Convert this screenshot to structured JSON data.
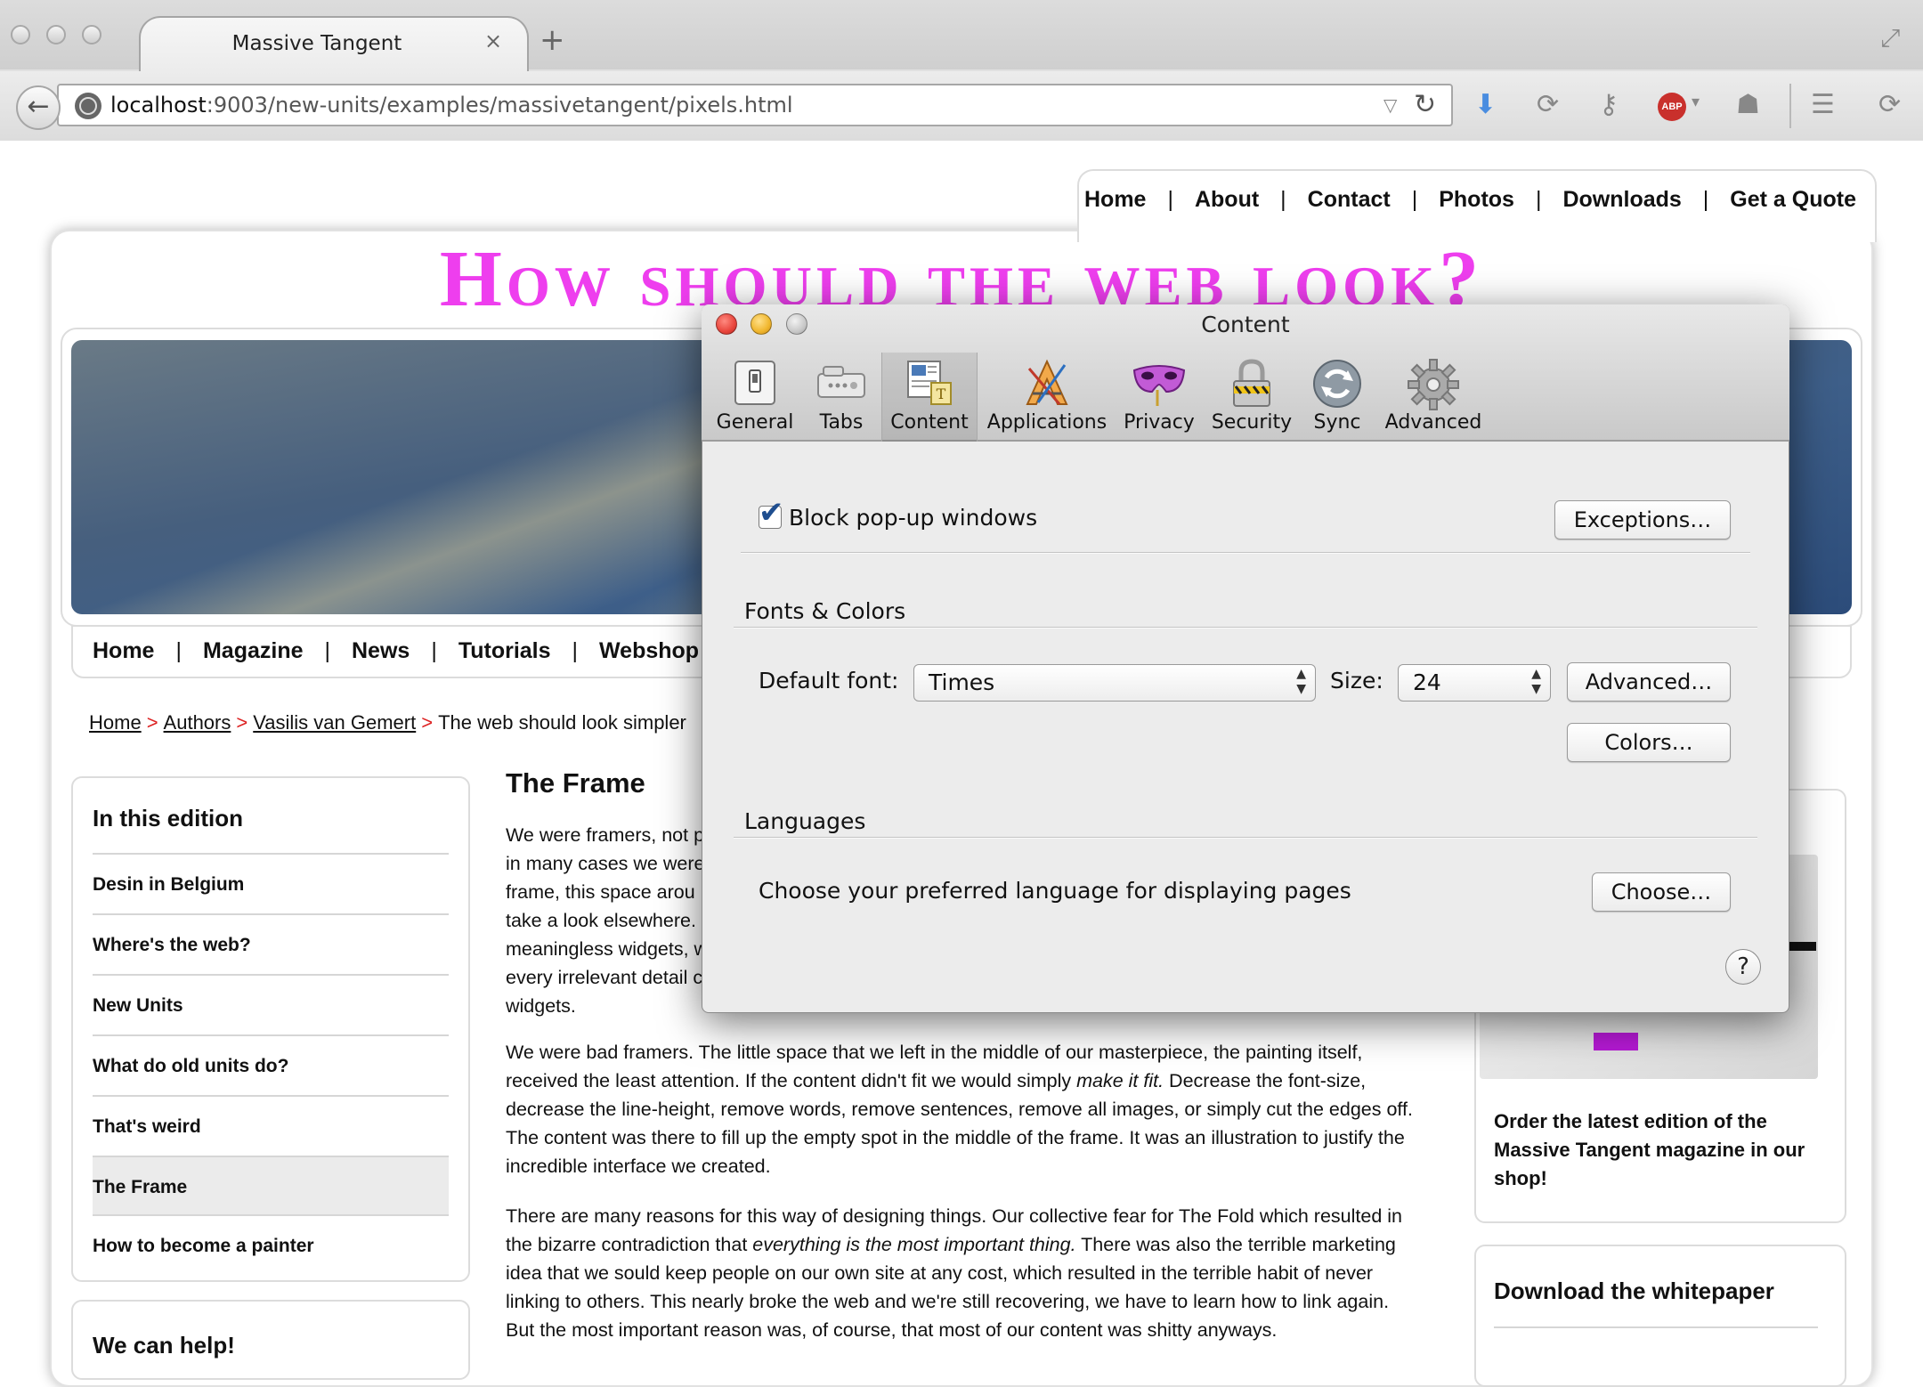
{
  "browser": {
    "tab_title": "Massive Tangent",
    "tab_close": "×",
    "new_tab": "+",
    "back_glyph": "←",
    "url_host": "localhost",
    "url_rest": ":9003/new-units/examples/massivetangent/pixels.html"
  },
  "page": {
    "top_nav": [
      "Home",
      "About",
      "Contact",
      "Photos",
      "Downloads",
      "Get a Quote"
    ],
    "headline": "How should the web look?",
    "sub_nav": [
      "Home",
      "Magazine",
      "News",
      "Tutorials",
      "Webshop"
    ],
    "breadcrumb": {
      "links": [
        "Home",
        "Authors",
        "Vasilis van Gemert"
      ],
      "current": "The web should look simpler",
      "separator": ">"
    },
    "sidebar": {
      "title": "In this edition",
      "items": [
        "Desin in Belgium",
        "Where's the web?",
        "New Units",
        "What do old units do?",
        "That's weird",
        "The Frame",
        "How to become a painter"
      ],
      "active": "The Frame"
    },
    "sidebar2_title": "We can help!",
    "article": {
      "title": "The Frame",
      "p1_lines": [
        "We were framers, not p",
        "in many cases we were",
        "frame, this space arou",
        "take a look elsewhere.",
        "meaningless widgets, w",
        "every irrelevant detail c",
        "widgets."
      ],
      "p2_a": "We were bad framers. The little space that we left in the middle of our masterpiece, the painting itself, received the least attention. If the content didn't fit we would simply ",
      "p2_em": "make it fit.",
      "p2_b": " Decrease the font-size, decrease the line-height, remove words, remove sentences, remove all images, or simply cut the edges off. The content was there to fill up the empty spot in the middle of the frame. It was an illustration to justify the incredible interface we created.",
      "p3_a": "There are many reasons for this way of designing things. Our collective fear for The Fold which resulted in the bizarre contradiction that ",
      "p3_em": "everything is the most important thing.",
      "p3_b": " There was also the terrible marketing idea that we sould keep people on our own site at any cost, which resulted in the terrible habit of never linking to others. This nearly broke the web and we're still recovering, we have to learn how to link again. But the most important reason was, of course, that most of our content was shitty anyways."
    },
    "promo_text": "Order the latest edition of the Massive Tangent magazine in our shop!",
    "whitepaper_title": "Download the whitepaper"
  },
  "dialog": {
    "title": "Content",
    "tabs": [
      {
        "label": "General",
        "icon": "switch-icon"
      },
      {
        "label": "Tabs",
        "icon": "tabs-icon"
      },
      {
        "label": "Content",
        "icon": "content-icon"
      },
      {
        "label": "Applications",
        "icon": "applications-icon"
      },
      {
        "label": "Privacy",
        "icon": "mask-icon"
      },
      {
        "label": "Security",
        "icon": "padlock-icon"
      },
      {
        "label": "Sync",
        "icon": "sync-icon"
      },
      {
        "label": "Advanced",
        "icon": "gear-icon"
      }
    ],
    "active_tab": "Content",
    "block_popups_label": "Block pop-up windows",
    "block_popups_checked": true,
    "exceptions_button": "Exceptions…",
    "fonts_colors_heading": "Fonts & Colors",
    "default_font_label": "Default font:",
    "default_font_value": "Times",
    "size_label": "Size:",
    "size_value": "24",
    "advanced_button": "Advanced…",
    "colors_button": "Colors…",
    "languages_heading": "Languages",
    "languages_text": "Choose your preferred language for displaying pages",
    "choose_button": "Choose…",
    "help_button": "?",
    "light_colors": {
      "close": "#e8453c",
      "minimize": "#f0b62d",
      "zoom": "#c8c8c8"
    }
  },
  "colors": {
    "headline": "#ee3eee",
    "breadcrumb_arrow": "#dd2222",
    "download_icon": "#4a8de0"
  }
}
